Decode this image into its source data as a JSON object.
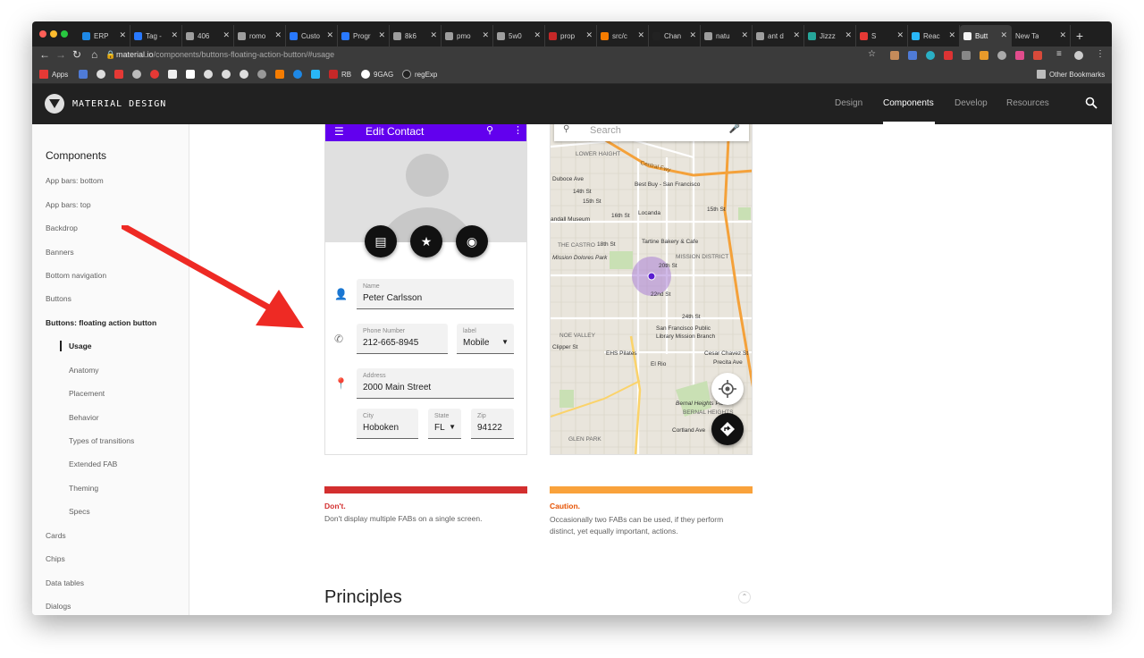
{
  "browser": {
    "tabs": [
      {
        "title": "ERP",
        "color": "#1e88e5"
      },
      {
        "title": "Tag -",
        "color": "#2979ff"
      },
      {
        "title": "406",
        "color": "#9e9e9e"
      },
      {
        "title": "romo",
        "color": "#9e9e9e"
      },
      {
        "title": "Custo",
        "color": "#2979ff"
      },
      {
        "title": "Progr",
        "color": "#2979ff"
      },
      {
        "title": "8k6",
        "color": "#9e9e9e"
      },
      {
        "title": "pmo",
        "color": "#9e9e9e"
      },
      {
        "title": "5w0",
        "color": "#9e9e9e"
      },
      {
        "title": "prop",
        "color": "#c62828"
      },
      {
        "title": "src/c",
        "color": "#f57c00"
      },
      {
        "title": "Chan",
        "color": "#222222"
      },
      {
        "title": "natu",
        "color": "#9e9e9e"
      },
      {
        "title": "ant d",
        "color": "#9e9e9e"
      },
      {
        "title": "Jizzz",
        "color": "#26a69a"
      },
      {
        "title": "S",
        "color": "#e53935"
      },
      {
        "title": "Reac",
        "color": "#29b6f6"
      },
      {
        "title": "Butt",
        "color": "#f5f5f5"
      },
      {
        "title": "New Tab",
        "color": "#9e9e9e"
      }
    ],
    "url_host": "material.io",
    "url_path": "/components/buttons-floating-action-button/#usage",
    "bookmarks": {
      "apps": "Apps",
      "rb": "RB",
      "ninegag": "9GAG",
      "regexp": "regExp",
      "other": "Other Bookmarks"
    }
  },
  "header": {
    "brand": "MATERIAL DESIGN",
    "nav": [
      "Design",
      "Components",
      "Develop",
      "Resources"
    ],
    "active_nav": "Components"
  },
  "sidebar": {
    "title": "Components",
    "items": [
      "App bars: bottom",
      "App bars: top",
      "Backdrop",
      "Banners",
      "Bottom navigation",
      "Buttons",
      "Buttons: floating action button"
    ],
    "sub_items": [
      "Usage",
      "Anatomy",
      "Placement",
      "Behavior",
      "Types of transitions",
      "Extended FAB",
      "Theming",
      "Specs"
    ],
    "items_after": [
      "Cards",
      "Chips",
      "Data tables",
      "Dialogs"
    ]
  },
  "example1": {
    "appbar_title": "Edit Contact",
    "name_label": "Name",
    "name_value": "Peter Carlsson",
    "phone_label": "Phone Number",
    "phone_value": "212-665-8945",
    "type_label": "label",
    "type_value": "Mobile",
    "address_label": "Address",
    "address_value": "2000 Main Street",
    "city_label": "City",
    "city_value": "Hoboken",
    "state_label": "State",
    "state_value": "FL",
    "zip_label": "Zip",
    "zip_value": "94122",
    "verdict": "Don't.",
    "caption": "Don't display multiple FABs on a single screen."
  },
  "example2": {
    "search_placeholder": "Search",
    "map_labels": {
      "lower_haight": "LOWER HAIGHT",
      "central_fwy": "Central Fwy",
      "duboce": "Duboce Ave",
      "best_buy": "Best Buy - San Francisco",
      "fourteenth": "14th St",
      "fifteenth": "15th St",
      "sixteenth": "16th St",
      "locanda": "Locanda",
      "museum": "andall Museum",
      "the_castro": "THE CASTRO",
      "eighteenth": "18th St",
      "tartine": "Tartine Bakery & Cafe",
      "mission_district": "MISSION DISTRICT",
      "mission_dolores": "Mission Dolores Park",
      "twentieth": "20th St",
      "twentysecond": "22nd St",
      "twentyfourth": "24th St",
      "noe_valley": "NOE VALLEY",
      "sfpl": "San Francisco Public",
      "sfpl2": "Library Mission Branch",
      "clipper": "Clipper St",
      "ehs": "EHS Pilates",
      "el_rio": "El Rio",
      "cesar": "Cesar Chavez St",
      "precita": "Precita Ave",
      "bernal": "Bernal Heights Park",
      "bernal_hts": "BERNAL HEIGHTS",
      "glen_park": "GLEN PARK",
      "cortland": "Cortland Ave"
    },
    "verdict": "Caution.",
    "caption": "Occasionally two FABs can be used, if they perform distinct, yet equally important, actions."
  },
  "section_title": "Principles",
  "colors": {
    "appbar": "#6200ee",
    "dont": "#d32f2f",
    "caution": "#f9a23b",
    "annotation_arrow": "#ee2a24"
  }
}
